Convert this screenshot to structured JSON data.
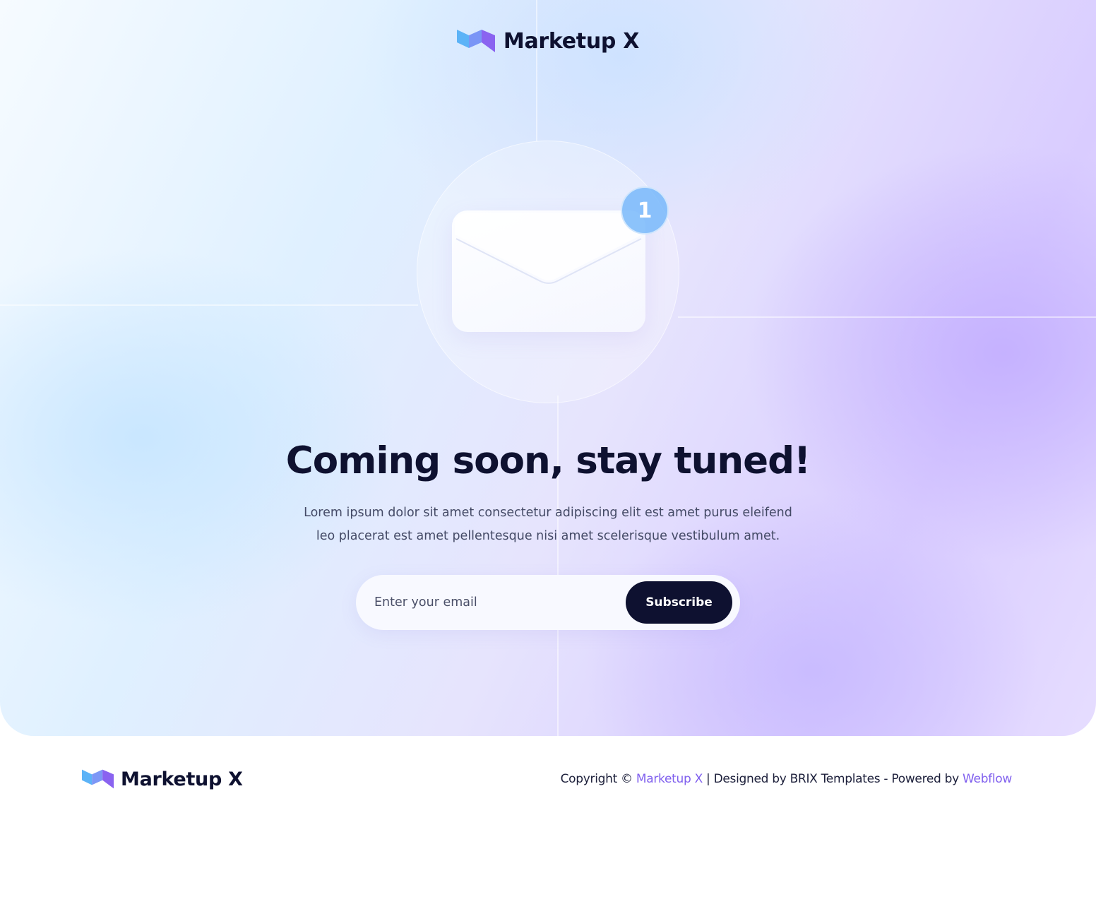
{
  "brand": {
    "name": "Marketup X",
    "colors": {
      "mark_blue": "#5cb3f7",
      "mark_purple": "#8a63f0",
      "dark": "#0e1130",
      "link": "#8060ee"
    }
  },
  "hero": {
    "notification_count": "1",
    "icon": "envelope-icon",
    "headline": "Coming soon, stay tuned!",
    "description": "Lorem ipsum dolor sit amet consectetur adipiscing elit est amet purus eleifend leo placerat est amet pellentesque nisi amet scelerisque vestibulum amet."
  },
  "subscribe_form": {
    "email_placeholder": "Enter your email",
    "button_label": "Subscribe"
  },
  "footer": {
    "copyright_prefix": "Copyright ©",
    "brand_link": "Marketup X",
    "designed_by": "| Designed by BRIX Templates - Powered by",
    "platform_link": "Webflow"
  }
}
